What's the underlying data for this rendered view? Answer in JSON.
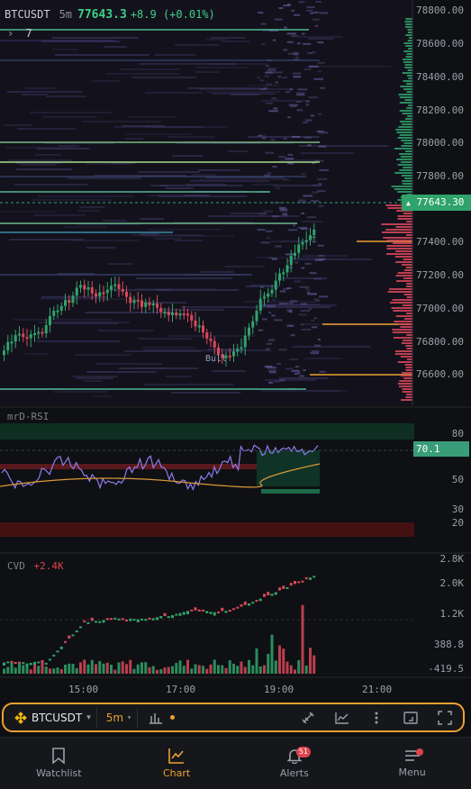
{
  "header": {
    "symbol": "BTCUSDT",
    "timeframe": "5m",
    "price": "77643.3",
    "change": "+8.9 (+0.01%)",
    "layers_count": "7"
  },
  "price_axis": {
    "labels": [
      "78800.00",
      "78600.00",
      "78400.00",
      "78200.00",
      "78000.00",
      "77800.00",
      "77400.00",
      "77200.00",
      "77000.00",
      "76800.00",
      "76600.00"
    ],
    "current_price_tag": "77643.30"
  },
  "rsi": {
    "title": "mrD-RSI",
    "levels": [
      "80",
      "50",
      "30",
      "20"
    ],
    "value_tag": "70.1"
  },
  "cvd": {
    "title": "CVD",
    "value": "+2.4K",
    "axis": [
      "2.8K",
      "2.0K",
      "1.2K",
      "388.8",
      "-419.5"
    ]
  },
  "chart_annotation": "Bull",
  "time_axis": [
    "15:00",
    "17:00",
    "19:00",
    "21:00"
  ],
  "toolbar": {
    "symbol": "BTCUSDT",
    "timeframe": "5m"
  },
  "nav": {
    "items": [
      {
        "label": "Watchlist",
        "icon": "bookmark-icon"
      },
      {
        "label": "Chart",
        "icon": "chart-icon"
      },
      {
        "label": "Alerts",
        "icon": "bell-icon",
        "badge": "51"
      },
      {
        "label": "Menu",
        "icon": "menu-icon"
      }
    ]
  },
  "colors": {
    "up": "#2fa36b",
    "down": "#d9485a",
    "accent": "#f0a030",
    "rsi_line": "#8e7cf0",
    "rsi_ma": "#d89a3a"
  }
}
